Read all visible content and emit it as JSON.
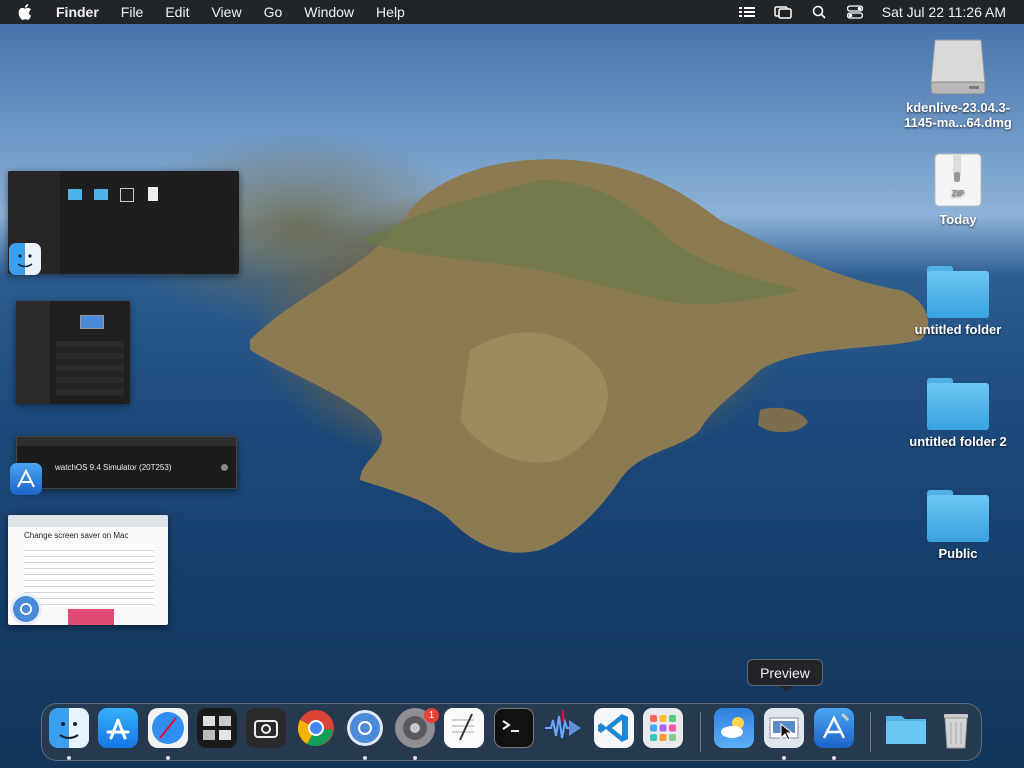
{
  "menubar": {
    "app_name": "Finder",
    "items": [
      "File",
      "Edit",
      "View",
      "Go",
      "Window",
      "Help"
    ],
    "clock": "Sat Jul 22  11:26 AM",
    "status_icons": [
      "sidebar-list-icon",
      "screen-mirroring-icon",
      "spotlight-search-icon",
      "control-center-icon"
    ]
  },
  "desktop": {
    "items": [
      {
        "label": "kdenlive-23.04.3-\n1145-ma...64.dmg",
        "icon": "disk-image-icon"
      },
      {
        "label": "Today",
        "icon": "zip-archive-icon"
      },
      {
        "label": "untitled folder",
        "icon": "folder-icon"
      },
      {
        "label": "untitled folder 2",
        "icon": "folder-icon"
      },
      {
        "label": "Public",
        "icon": "folder-icon"
      }
    ]
  },
  "window_thumbnails": {
    "simulator_label": "watchOS 9.4 Simulator (20T253)",
    "browser_heading": "Change screen saver on Mac"
  },
  "dock": {
    "apps": [
      "Finder",
      "App Store",
      "Safari",
      "Mission Control",
      "Screenshot",
      "Google Chrome",
      "Chromium",
      "System Settings",
      "TextEdit",
      "Terminal",
      "Instruments",
      "Visual Studio Code",
      "Launchpad",
      "Weather",
      "Preview",
      "Xcode",
      "Downloads",
      "Trash"
    ],
    "settings_badge": "1",
    "tooltip": "Preview"
  },
  "colors": {
    "folder_blue": "#4fb3ea",
    "menubar_bg": "#1e1e1e",
    "badge_red": "#e8413a"
  }
}
